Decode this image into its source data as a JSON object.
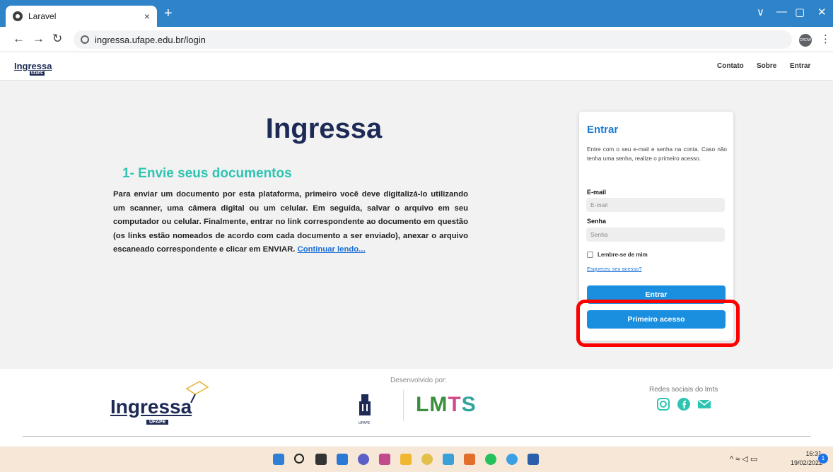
{
  "browser": {
    "tab_title": "Laravel",
    "tab_close": "×",
    "new_tab": "+",
    "url": "ingressa.ufape.edu.br/login",
    "extension_label": "DROW",
    "window_controls": [
      "∨",
      "—",
      "▢",
      "✕"
    ]
  },
  "header": {
    "logo_text": "Ingressa",
    "logo_sub": "UFAPE",
    "nav": [
      "Contato",
      "Sobre",
      "Entrar"
    ]
  },
  "main": {
    "title": "Ingressa",
    "step_title": "1- Envie seus documentos",
    "step_text": "Para enviar um documento por esta plataforma, primeiro você deve digitalizá-lo utilizando um scanner, uma câmera digital ou um celular. Em seguida, salvar o arquivo em seu computador ou celular. Finalmente, entrar no link correspondente ao documento em questão (os links estão nomeados de acordo com cada documento a ser enviado), anexar o arquivo escaneado correspondente e clicar em ENVIAR. ",
    "read_more": "Continuar lendo..."
  },
  "login": {
    "title": "Entrar",
    "description": "Entre com o seu e-mail e senha na conta. Caso não tenha uma senha, realize o primeiro acesso.",
    "email_label": "E-mail",
    "email_placeholder": "E-mail",
    "password_label": "Senha",
    "password_placeholder": "Senha",
    "remember": "Lembre-se de mim",
    "forgot": "Esqueceu seu acesso?",
    "submit": "Entrar",
    "first_access": "Primeiro acesso"
  },
  "footer": {
    "logo_text": "Ingressa",
    "logo_sub": "UFAPE",
    "developed_by": "Desenvolvido por:",
    "lmts_parts": [
      "LM",
      "T",
      "S"
    ],
    "tower_sub": "UFAPE",
    "social_label": "Redes sociais do lmts"
  },
  "taskbar": {
    "time": "16:31",
    "date": "19/02/2022",
    "notifications": "1"
  },
  "colors": {
    "accent": "#1a8fe0",
    "navy": "#1c2a55",
    "teal": "#2fc4b2",
    "highlight": "#ff0000"
  }
}
